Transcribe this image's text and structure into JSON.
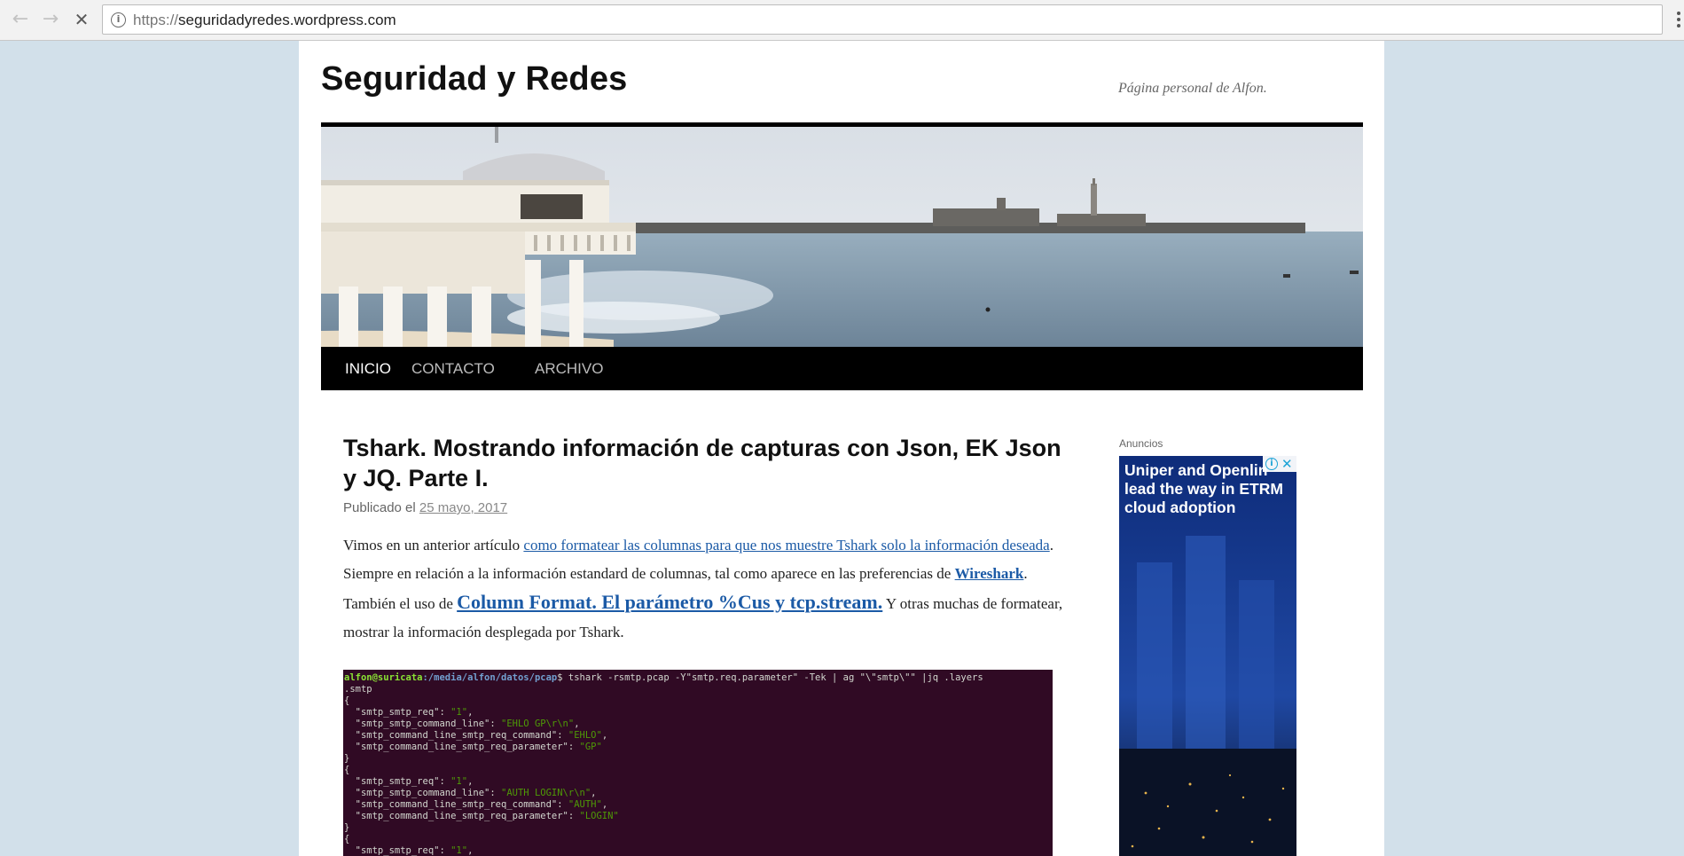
{
  "browser": {
    "url_scheme": "https://",
    "url_host": "seguridadyredes.wordpress.com",
    "back_icon": "arrow-left-icon",
    "forward_icon": "arrow-right-icon",
    "stop_icon": "close-icon"
  },
  "site": {
    "title": "Seguridad y Redes",
    "tagline": "Página personal de Alfon."
  },
  "menu": {
    "items": [
      "INICIO",
      "CONTACTO",
      "ARCHIVO"
    ],
    "active": "INICIO"
  },
  "post": {
    "title": "Tshark. Mostrando información de capturas con Json, EK Json y JQ. Parte I.",
    "meta_prefix": "Publicado el",
    "date": "25 mayo, 2017",
    "p1": "Vimos en un anterior artículo ",
    "link1": "como formatear las columnas para que nos muestre Tshark solo la información deseada",
    "p2": ". Siempre en relación a la información estandard de columnas, tal como aparece en las preferencias de ",
    "link2": "Wireshark",
    "p3": ". También el uso de ",
    "link3": "Column Format. El parámetro %Cus y tcp.stream.",
    "p4": " Y otras muchas de formatear, mostrar la información desplegada por Tshark."
  },
  "terminal": {
    "prompt_user": "alfon@suricata",
    "prompt_path": ":/media/alfon/datos/pcap",
    "command": "$ tshark -rsmtp.pcap -Y\"smtp.req.parameter\" -Tek | ag \"\\\"smtp\\\"\" |jq .layers",
    "command_wrap": ".smtp",
    "blocks": [
      {
        "smtp_smtp_req": "\"1\"",
        "smtp_smtp_command_line": "\"EHLO GP\\r\\n\"",
        "smtp_command_line_smtp_req_command": "\"EHLO\"",
        "smtp_command_line_smtp_req_parameter": "\"GP\""
      },
      {
        "smtp_smtp_req": "\"1\"",
        "smtp_smtp_command_line": "\"AUTH LOGIN\\r\\n\"",
        "smtp_command_line_smtp_req_command": "\"AUTH\"",
        "smtp_command_line_smtp_req_parameter": "\"LOGIN\""
      },
      {
        "smtp_smtp_req": "\"1\""
      }
    ]
  },
  "sidebar": {
    "ads_label": "Anuncios",
    "ad_text": "Uniper and OpenLink lead the way in ETRM cloud adoption",
    "ad_text_visible": "Uniper and Openlin lead the way in ETRM cloud adoption",
    "ad_info_icon": "info-icon",
    "ad_close_icon": "close-icon"
  },
  "colors": {
    "page_bg": "#d2e0ea",
    "link": "#1b5aa6",
    "menu_bg": "#000000",
    "terminal_bg": "#300a24"
  }
}
